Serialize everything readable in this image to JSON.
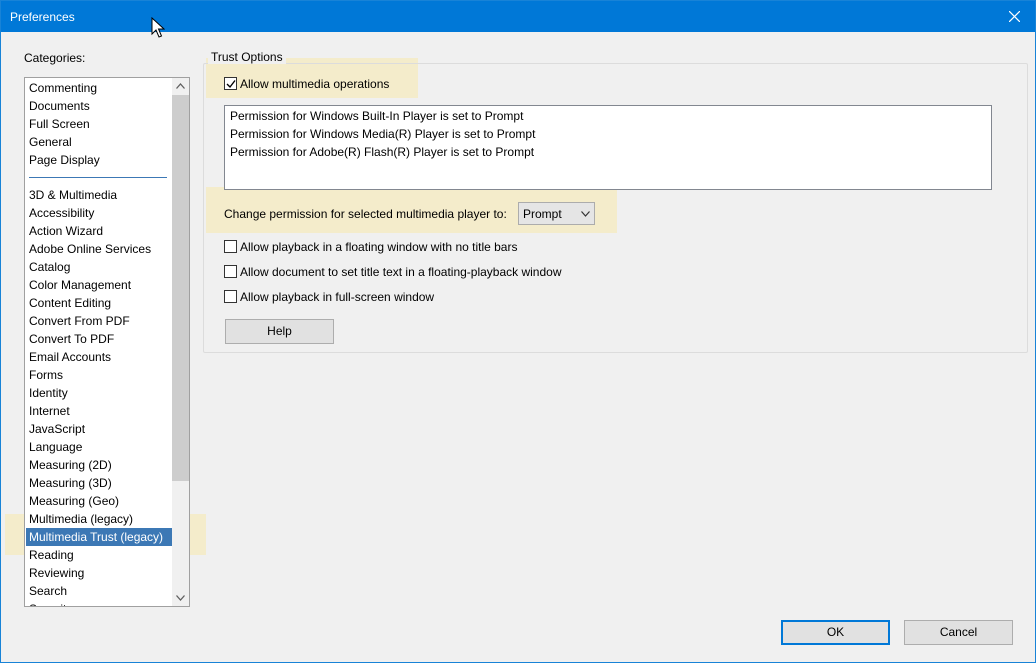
{
  "window": {
    "title": "Preferences"
  },
  "categories": {
    "label": "Categories:",
    "top_group": [
      "Commenting",
      "Documents",
      "Full Screen",
      "General",
      "Page Display"
    ],
    "items": [
      "3D & Multimedia",
      "Accessibility",
      "Action Wizard",
      "Adobe Online Services",
      "Catalog",
      "Color Management",
      "Content Editing",
      "Convert From PDF",
      "Convert To PDF",
      "Email Accounts",
      "Forms",
      "Identity",
      "Internet",
      "JavaScript",
      "Language",
      "Measuring (2D)",
      "Measuring (3D)",
      "Measuring (Geo)",
      "Multimedia (legacy)",
      "Multimedia Trust (legacy)",
      "Reading",
      "Reviewing",
      "Search",
      "Security"
    ],
    "selected": "Multimedia Trust (legacy)"
  },
  "trust_options": {
    "group_title": "Trust Options",
    "allow_multimedia": {
      "label": "Allow multimedia operations",
      "checked": true
    },
    "permissions": [
      "Permission for Windows Built-In Player is set to Prompt",
      "Permission for Windows Media(R) Player is set to Prompt",
      "Permission for Adobe(R) Flash(R) Player is set to Prompt"
    ],
    "change_permission_label": "Change permission for selected multimedia player to:",
    "change_permission_value": "Prompt",
    "options": [
      {
        "label": "Allow playback in a floating window with no title bars",
        "checked": false
      },
      {
        "label": "Allow document to set title text in a floating-playback window",
        "checked": false
      },
      {
        "label": "Allow playback in full-screen window",
        "checked": false
      }
    ],
    "help_label": "Help"
  },
  "footer": {
    "ok_label": "OK",
    "cancel_label": "Cancel"
  },
  "colors": {
    "titlebar": "#0078d7",
    "selection": "#3c78b5",
    "highlight": "#f5ebc4"
  }
}
